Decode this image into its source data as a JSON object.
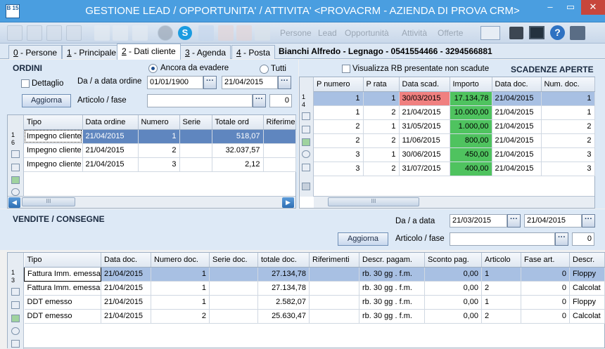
{
  "window": {
    "title": "GESTIONE LEAD / OPPORTUNITA' / ATTIVITA' <PROVACRM - AZIENDA DI PROVA CRM>",
    "logo_text": "B 15",
    "min_label": "–",
    "max_label": "▭",
    "close_label": "✕"
  },
  "toolbar": {
    "menus": [
      "Persone",
      "Lead",
      "Opportunità",
      "Attività",
      "Offerte"
    ]
  },
  "tabs": [
    {
      "key": "0",
      "label": " - Persone"
    },
    {
      "key": "1",
      "label": " - Principale"
    },
    {
      "key": "2",
      "label": " - Dati cliente"
    },
    {
      "key": "3",
      "label": " - Agenda"
    },
    {
      "key": "4",
      "label": " - Posta"
    }
  ],
  "customer_info": "Bianchi Alfredo   - Legnago - 0541554466 - 3294566881",
  "ordini": {
    "title": "ORDINI",
    "radio_evadere": "Ancora da evadere",
    "radio_tutti": "Tutti",
    "dettaglio_label": "Dettaglio",
    "date_range_label": "Da / a data ordine",
    "date_from": "01/01/1900",
    "date_to": "21/04/2015",
    "aggiorna_label": "Aggiorna",
    "articolo_label": "Articolo / fase",
    "articolo_value": "",
    "fase_value": "0",
    "row_count_top": "1",
    "row_count_bottom": "6",
    "columns": [
      "Tipo",
      "Data ordine",
      "Numero",
      "Serie",
      "Totale ord",
      "Riferimenti"
    ],
    "rows": [
      [
        "Impegno cliente",
        "21/04/2015",
        "1",
        "",
        "518,07",
        ""
      ],
      [
        "Impegno cliente",
        "21/04/2015",
        "2",
        "",
        "32.037,57",
        ""
      ],
      [
        "Impegno cliente",
        "21/04/2015",
        "3",
        "",
        "2,12",
        ""
      ]
    ],
    "scroll_thumb": "III"
  },
  "scadenze": {
    "checkbox_label": "Visualizza RB presentate non scadute",
    "title": "SCADENZE APERTE",
    "row_count_top": "1",
    "row_count_bottom": "4",
    "columns": [
      "P numero",
      "P rata",
      "Data scad.",
      "Importo",
      "Data doc.",
      "Num. doc."
    ],
    "rows": [
      [
        "1",
        "1",
        "30/03/2015",
        "17.134,78",
        "21/04/2015",
        "1"
      ],
      [
        "1",
        "2",
        "21/04/2015",
        "10.000,00",
        "21/04/2015",
        "1"
      ],
      [
        "2",
        "1",
        "31/05/2015",
        "1.000,00",
        "21/04/2015",
        "2"
      ],
      [
        "2",
        "2",
        "11/06/2015",
        "800,00",
        "21/04/2015",
        "2"
      ],
      [
        "3",
        "1",
        "30/06/2015",
        "450,00",
        "21/04/2015",
        "3"
      ],
      [
        "3",
        "2",
        "31/07/2015",
        "400,00",
        "21/04/2015",
        "3"
      ]
    ],
    "scroll_thumb": "III"
  },
  "vendite": {
    "title": "VENDITE / CONSEGNE",
    "date_range_label": "Da / a data",
    "date_from": "21/03/2015",
    "date_to": "21/04/2015",
    "aggiorna_label": "Aggiorna",
    "articolo_label": "Articolo / fase",
    "articolo_value": "",
    "fase_value": "0",
    "row_count_top": "1",
    "row_count_bottom": "3",
    "columns": [
      "Tipo",
      "Data doc.",
      "Numero doc.",
      "Serie doc.",
      "totale doc.",
      "Riferimenti",
      "Descr. pagam.",
      "Sconto pag.",
      "Articolo",
      "Fase art.",
      "Descr."
    ],
    "rows": [
      [
        "Fattura Imm. emessa",
        "21/04/2015",
        "1",
        "",
        "27.134,78",
        "",
        "rb. 30 gg . f.m.",
        "0,00",
        "1",
        "0",
        "Floppy"
      ],
      [
        "Fattura Imm. emessa",
        "21/04/2015",
        "1",
        "",
        "27.134,78",
        "",
        "rb. 30 gg . f.m.",
        "0,00",
        "2",
        "0",
        "Calcolat"
      ],
      [
        "DDT emesso",
        "21/04/2015",
        "1",
        "",
        "2.582,07",
        "",
        "rb. 30 gg . f.m.",
        "0,00",
        "1",
        "0",
        "Floppy"
      ],
      [
        "DDT emesso",
        "21/04/2015",
        "2",
        "",
        "25.630,47",
        "",
        "rb. 30 gg . f.m.",
        "0,00",
        "2",
        "0",
        "Calcolat"
      ]
    ]
  },
  "colors": {
    "title_bar": "#4a9ee0",
    "panel": "#dde9f6",
    "selected_row": "#5f86bf",
    "overdue": "#f08080",
    "amount": "#4fc35f"
  }
}
